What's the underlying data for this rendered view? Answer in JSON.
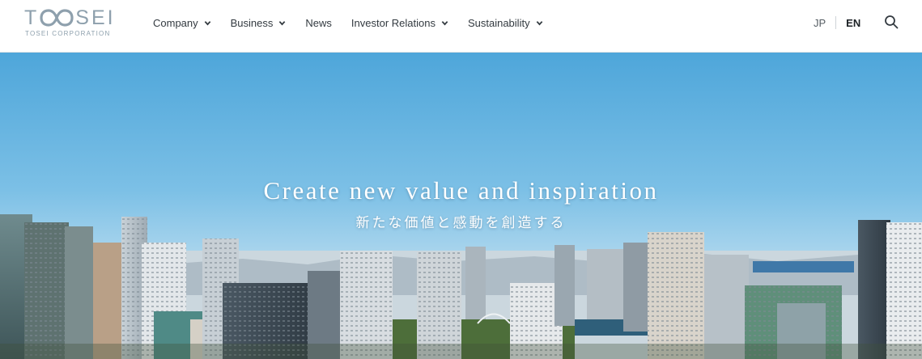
{
  "brand": {
    "logo_letters_left": "T",
    "logo_letters_right": "SEI",
    "logo_subtitle": "TOSEI CORPORATION",
    "color": "#8ea0ad"
  },
  "nav": {
    "items": [
      {
        "label": "Company",
        "has_dropdown": true
      },
      {
        "label": "Business",
        "has_dropdown": true
      },
      {
        "label": "News",
        "has_dropdown": false
      },
      {
        "label": "Investor Relations",
        "has_dropdown": true
      },
      {
        "label": "Sustainability",
        "has_dropdown": true
      }
    ]
  },
  "language": {
    "jp": "JP",
    "en": "EN",
    "active": "EN"
  },
  "search": {
    "icon": "search-icon"
  },
  "hero": {
    "title": "Create new value and inspiration",
    "subtitle": "新たな価値と感動を創造する",
    "sky_color": "#5fb0dd"
  }
}
